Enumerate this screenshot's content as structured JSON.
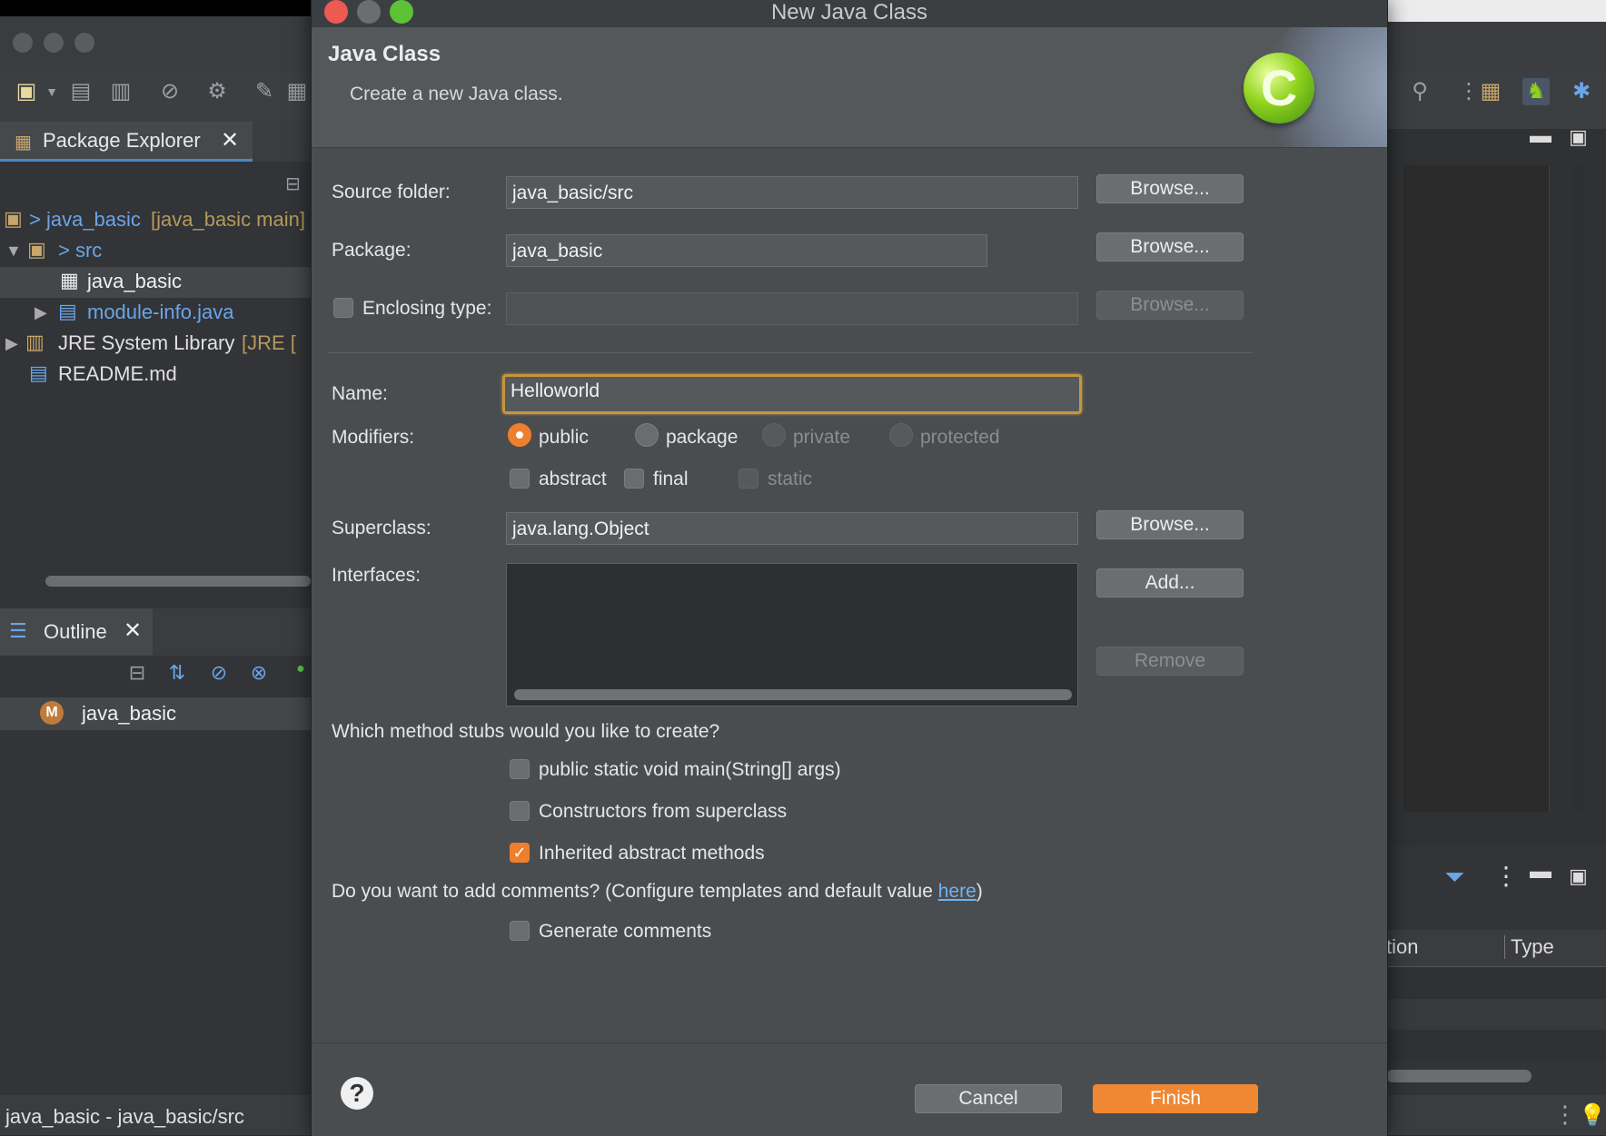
{
  "ide": {
    "package_explorer": {
      "tab_label": "Package Explorer",
      "tree": [
        {
          "label": "> java_basic",
          "suffix": " [java_basic main]",
          "expanded": false
        },
        {
          "label": "> src",
          "suffix": "",
          "expanded": true
        },
        {
          "label": "java_basic",
          "suffix": "",
          "selected": true
        },
        {
          "label": "module-info.java",
          "suffix": ""
        },
        {
          "label": "JRE System Library",
          "suffix": " [JRE ["
        },
        {
          "label": "README.md",
          "suffix": ""
        }
      ]
    },
    "outline": {
      "tab_label": "Outline",
      "item": "java_basic"
    },
    "status_text": "java_basic - java_basic/src",
    "right_bottom_columns": [
      "tion",
      "Type"
    ]
  },
  "dialog": {
    "window_title": "New Java Class",
    "header_title": "Java Class",
    "header_message": "Create a new Java class.",
    "source_folder": {
      "label": "Source folder:",
      "value": "java_basic/src",
      "browse": "Browse..."
    },
    "package": {
      "label": "Package:",
      "value": "java_basic",
      "browse": "Browse..."
    },
    "enclosing_type": {
      "label": "Enclosing type:",
      "value": "",
      "browse": "Browse...",
      "checked": false
    },
    "name": {
      "label": "Name:",
      "value": "Helloworld"
    },
    "modifiers": {
      "label": "Modifiers:",
      "access": [
        {
          "label": "public",
          "selected": true,
          "enabled": true
        },
        {
          "label": "package",
          "selected": false,
          "enabled": true
        },
        {
          "label": "private",
          "selected": false,
          "enabled": false
        },
        {
          "label": "protected",
          "selected": false,
          "enabled": false
        }
      ],
      "flags": [
        {
          "label": "abstract",
          "checked": false,
          "enabled": true
        },
        {
          "label": "final",
          "checked": false,
          "enabled": true
        },
        {
          "label": "static",
          "checked": false,
          "enabled": false
        }
      ]
    },
    "superclass": {
      "label": "Superclass:",
      "value": "java.lang.Object",
      "browse": "Browse..."
    },
    "interfaces": {
      "label": "Interfaces:",
      "add": "Add...",
      "remove": "Remove"
    },
    "stubs": {
      "question": "Which method stubs would you like to create?",
      "options": [
        {
          "label": "public static void main(String[] args)",
          "checked": false
        },
        {
          "label": "Constructors from superclass",
          "checked": false
        },
        {
          "label": "Inherited abstract methods",
          "checked": true
        }
      ]
    },
    "comments": {
      "question_prefix": "Do you want to add comments? (Configure templates and default value ",
      "link": "here",
      "question_suffix": ")",
      "option": "Generate comments",
      "checked": false
    },
    "cancel": "Cancel",
    "finish": "Finish",
    "help_symbol": "?"
  },
  "colors": {
    "accent_orange": "#f08733",
    "name_focus": "#c5963e",
    "logo_green": "#8fd21e",
    "link": "#72b1ef"
  }
}
